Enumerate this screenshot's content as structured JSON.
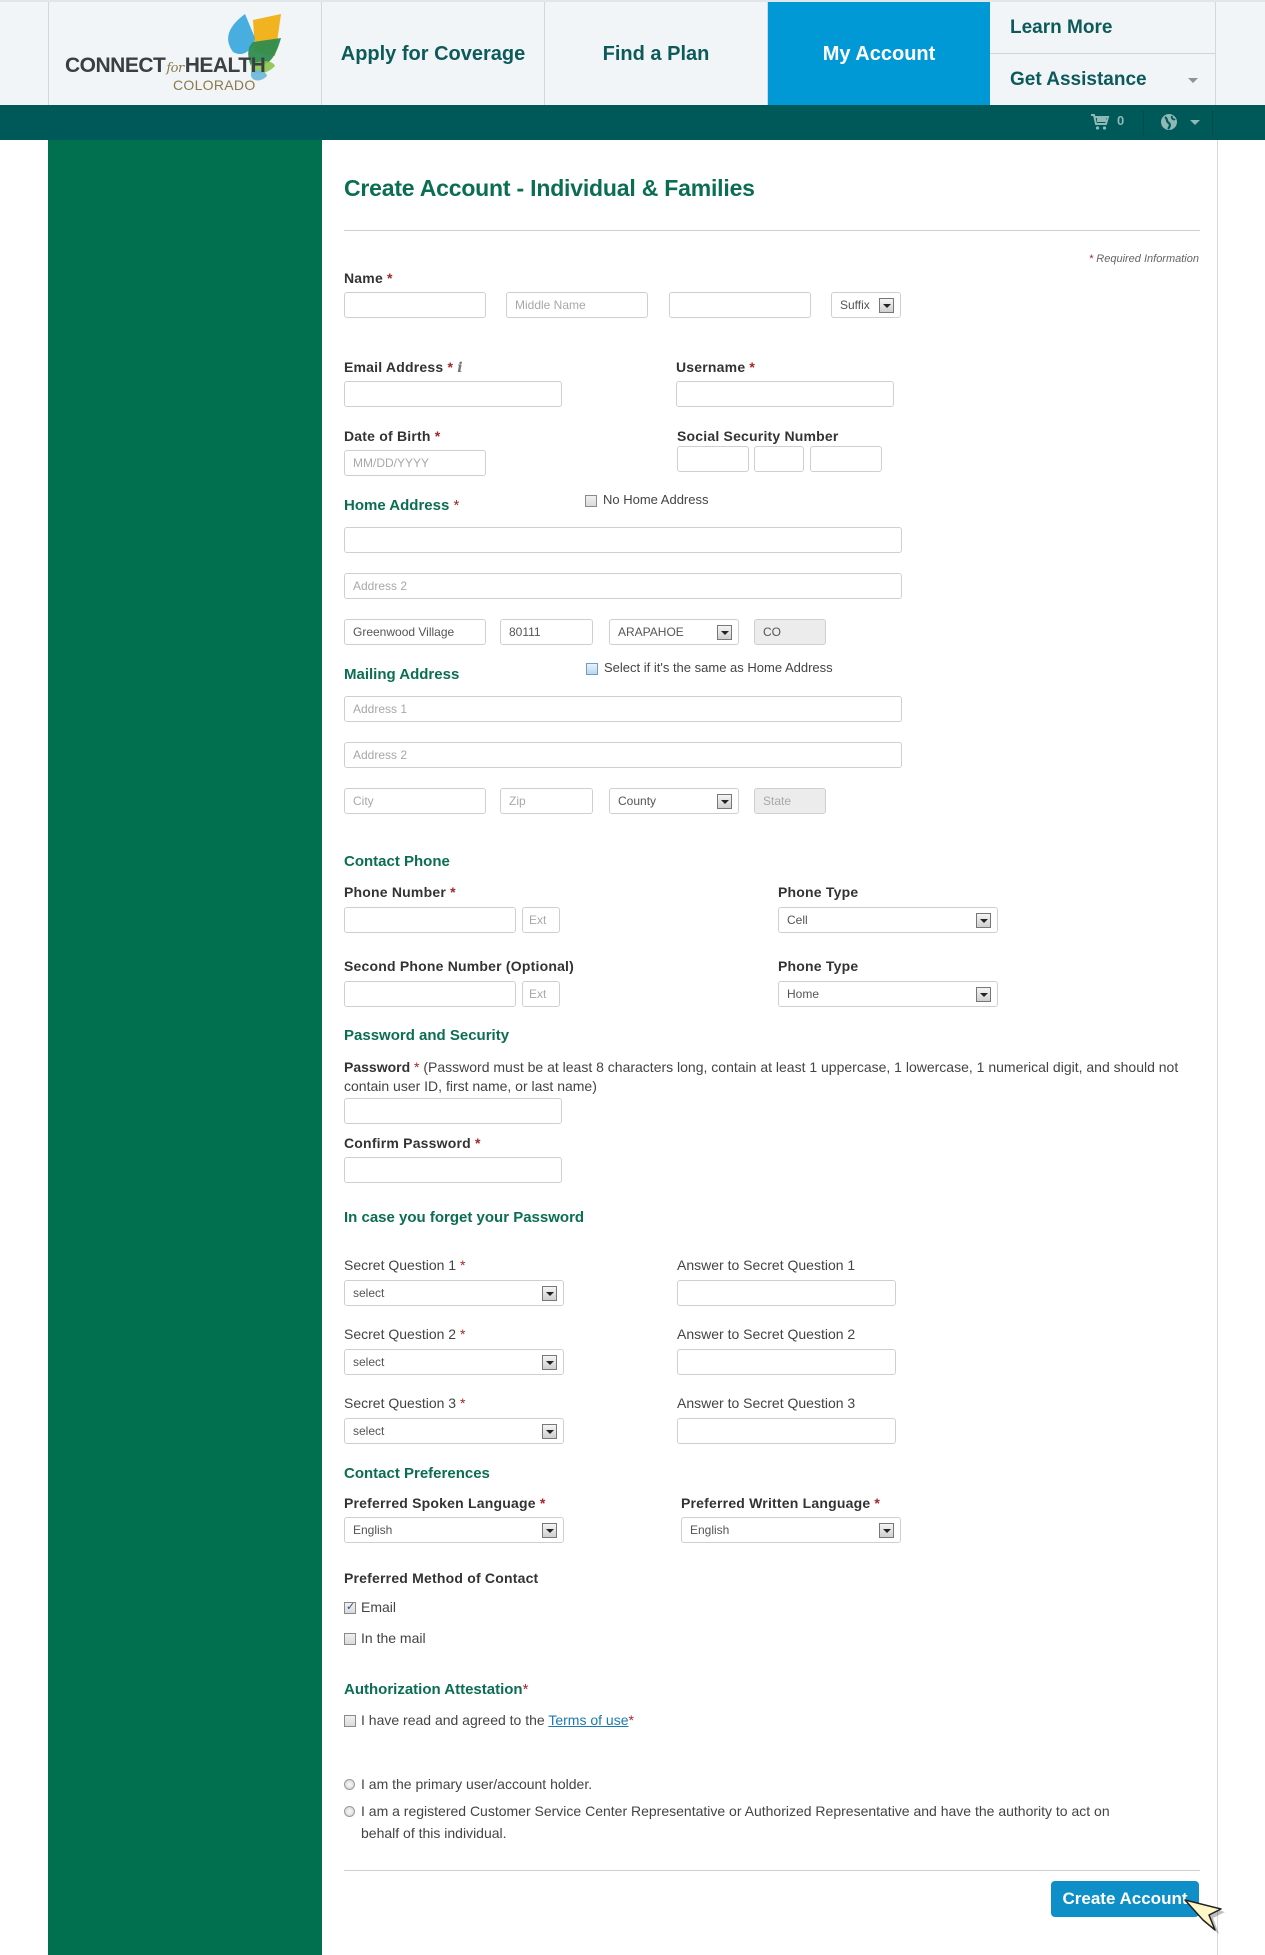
{
  "header": {
    "logo": {
      "main": "CONNECT",
      "for": "for",
      "health": "HEALTH",
      "sub": "COLORADO"
    },
    "nav": {
      "apply": "Apply for Coverage",
      "find_plan": "Find a Plan",
      "my_account": "My Account",
      "learn_more": "Learn More",
      "get_assistance": "Get Assistance"
    },
    "cart_count": "0"
  },
  "colors": {
    "brand_green": "#0b6e52",
    "sidebar_green": "#00704f",
    "teal_bar": "#005959",
    "active_nav": "#0099d6",
    "button": "#0f8fc8",
    "required": "#a3262b"
  },
  "form": {
    "title": "Create Account - Individual & Families",
    "required_note": "Required Information",
    "name": {
      "label": "Name",
      "first": "",
      "middle_placeholder": "Middle Name",
      "last": "",
      "suffix": "Suffix"
    },
    "email": {
      "label": "Email Address",
      "value": ""
    },
    "username": {
      "label": "Username",
      "value": ""
    },
    "dob": {
      "label": "Date of Birth",
      "placeholder": "MM/DD/YYYY"
    },
    "ssn": {
      "label": "Social Security Number"
    },
    "home_address": {
      "label": "Home Address",
      "no_home_label": "No Home Address",
      "address1": "",
      "address2_placeholder": "Address 2",
      "city": "Greenwood Village",
      "zip": "80111",
      "county": "ARAPAHOE",
      "state": "CO"
    },
    "mailing_address": {
      "label": "Mailing Address",
      "same_label": "Select if it's the same as Home Address",
      "address1_placeholder": "Address 1",
      "address2_placeholder": "Address 2",
      "city_placeholder": "City",
      "zip_placeholder": "Zip",
      "county": "County",
      "state_placeholder": "State"
    },
    "contact_phone": {
      "section": "Contact Phone",
      "phone_label": "Phone Number",
      "ext_placeholder": "Ext",
      "phone_type_label": "Phone Type",
      "phone_type": "Cell",
      "second_label": "Second Phone Number (Optional)",
      "second_type_label": "Phone Type",
      "second_type": "Home"
    },
    "password": {
      "section": "Password and Security",
      "label": "Password",
      "hint": "(Password must be at least 8 characters long, contain at least 1 uppercase, 1 lowercase, 1 numerical digit, and should not contain user ID, first name, or last name)",
      "confirm_label": "Confirm Password"
    },
    "secret": {
      "section": "In case you forget your Password",
      "questions": [
        {
          "label": "Secret Question 1",
          "value": "select",
          "answer_label": "Answer to Secret Question 1"
        },
        {
          "label": "Secret Question 2",
          "value": "select",
          "answer_label": "Answer to Secret Question 2"
        },
        {
          "label": "Secret Question 3",
          "value": "select",
          "answer_label": "Answer to Secret Question 3"
        }
      ]
    },
    "preferences": {
      "section": "Contact Preferences",
      "spoken_label": "Preferred Spoken Language",
      "spoken": "English",
      "written_label": "Preferred Written Language",
      "written": "English",
      "method_label": "Preferred Method of Contact",
      "methods": [
        {
          "label": "Email",
          "checked": true
        },
        {
          "label": "In the mail",
          "checked": false
        }
      ]
    },
    "attestation": {
      "section": "Authorization Attestation",
      "terms_prefix": "I have read and agreed to the",
      "terms_link": "Terms of use",
      "radio_primary": "I am the primary user/account holder.",
      "radio_rep_line1": "I am a registered Customer Service Center Representative or Authorized Representative and have the authority to act on",
      "radio_rep_line2": "behalf of this individual."
    },
    "submit": "Create Account"
  }
}
